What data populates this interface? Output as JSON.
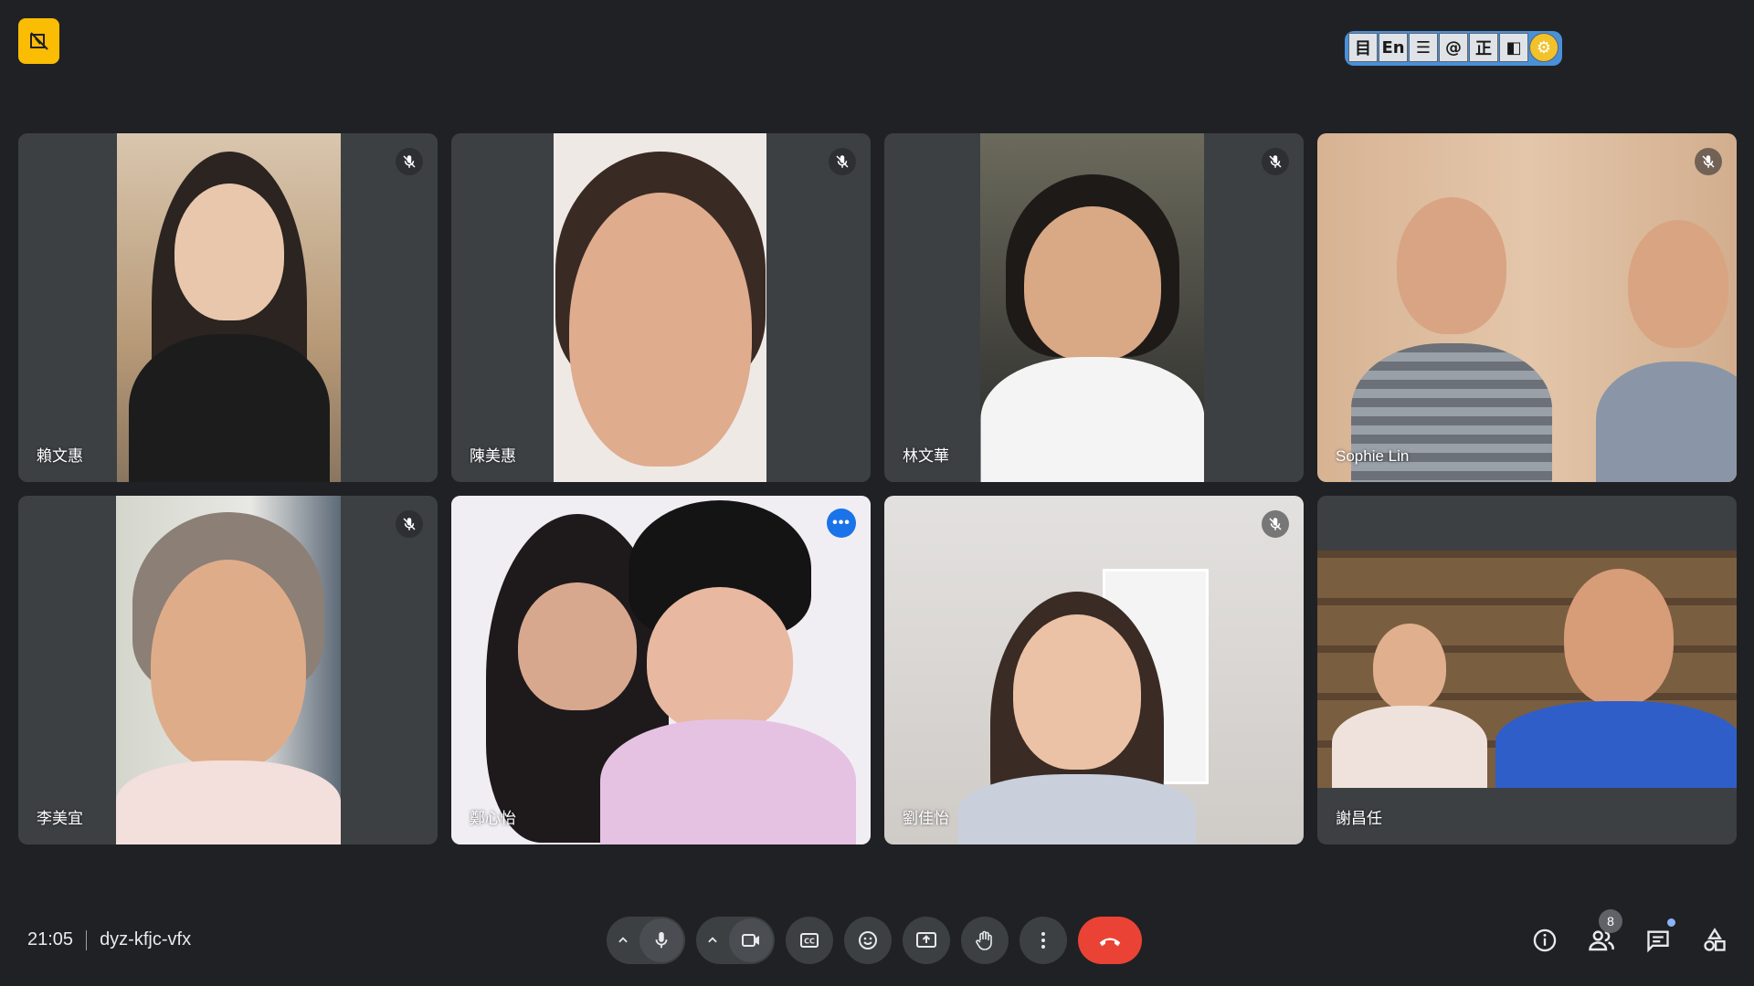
{
  "app": {
    "brand_color": "#fbbc04",
    "status_icon": "camera-off-icon"
  },
  "ime_toolbar": {
    "buttons": [
      "目",
      "En",
      "☰",
      "@",
      "正",
      "◧",
      "⚙"
    ]
  },
  "participants": [
    {
      "name": "賴文惠",
      "muted": true,
      "bg": "#3c4043"
    },
    {
      "name": "陳美惠",
      "muted": true,
      "bg": "#3c4043"
    },
    {
      "name": "林文華",
      "muted": true,
      "bg": "#3c4043"
    },
    {
      "name": "Sophie Lin",
      "muted": true,
      "bg": "#d9b89c"
    },
    {
      "name": "李美宜",
      "muted": true,
      "bg": "#3c4043"
    },
    {
      "name": "鄭心怡",
      "muted": false,
      "speaking": true,
      "bg": "#f0eef2"
    },
    {
      "name": "劉佳怡",
      "muted": true,
      "bg": "#d8d6d4"
    },
    {
      "name": "謝昌任",
      "muted": false,
      "bg": "#3c4043"
    }
  ],
  "meeting": {
    "time": "21:05",
    "code": "dyz-kfjc-vfx"
  },
  "controls": {
    "mic": "microphone-icon",
    "camera": "video-camera-icon",
    "captions_icon": "CC",
    "emoji": "emoji-icon",
    "present": "present-screen-icon",
    "raise_hand": "raise-hand-icon",
    "more": "more-options-icon",
    "hangup": "leave-call-icon",
    "hangup_color": "#ea4335"
  },
  "right_tools": {
    "people_count": "8",
    "accent": "#8ab4f8"
  }
}
